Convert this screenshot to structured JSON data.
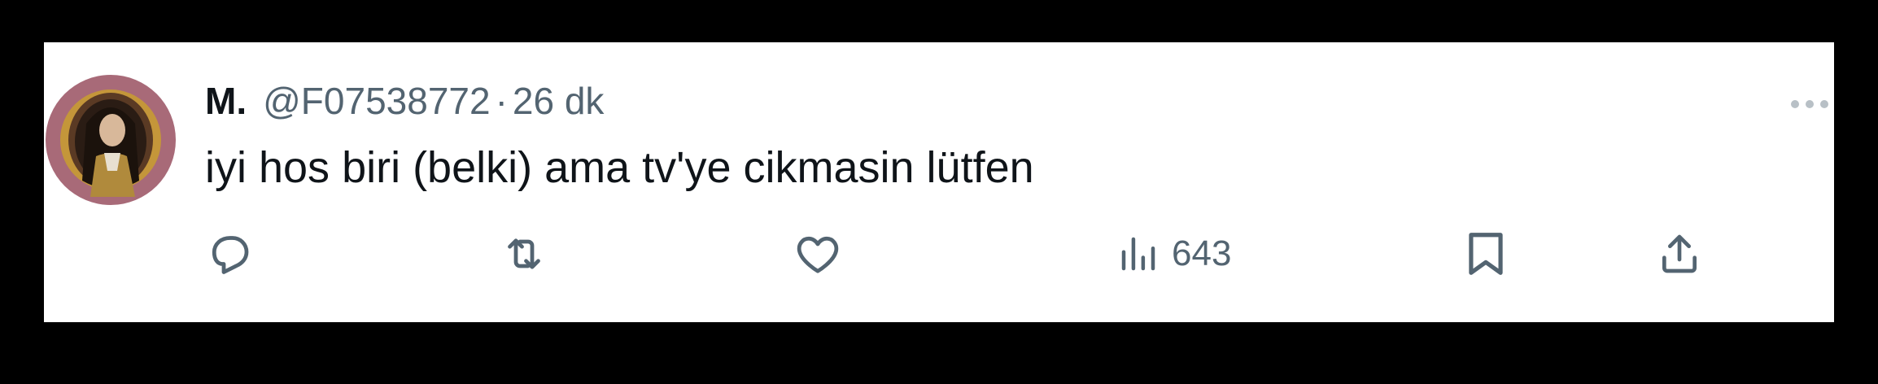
{
  "tweet": {
    "display_name": "M.",
    "handle": "@F07538772",
    "separator": "·",
    "time": "26 dk",
    "text": "iyi hos biri (belki) ama tv'ye cikmasin lütfen"
  },
  "actions": {
    "views_count": "643"
  },
  "icons": {
    "more": "more-horizontal-icon",
    "reply": "reply-icon",
    "retweet": "retweet-icon",
    "like": "heart-icon",
    "views": "views-chart-icon",
    "bookmark": "bookmark-icon",
    "share": "share-icon"
  },
  "colors": {
    "background": "#000000",
    "card": "#ffffff",
    "text_primary": "#0f1419",
    "text_secondary": "#536471"
  }
}
